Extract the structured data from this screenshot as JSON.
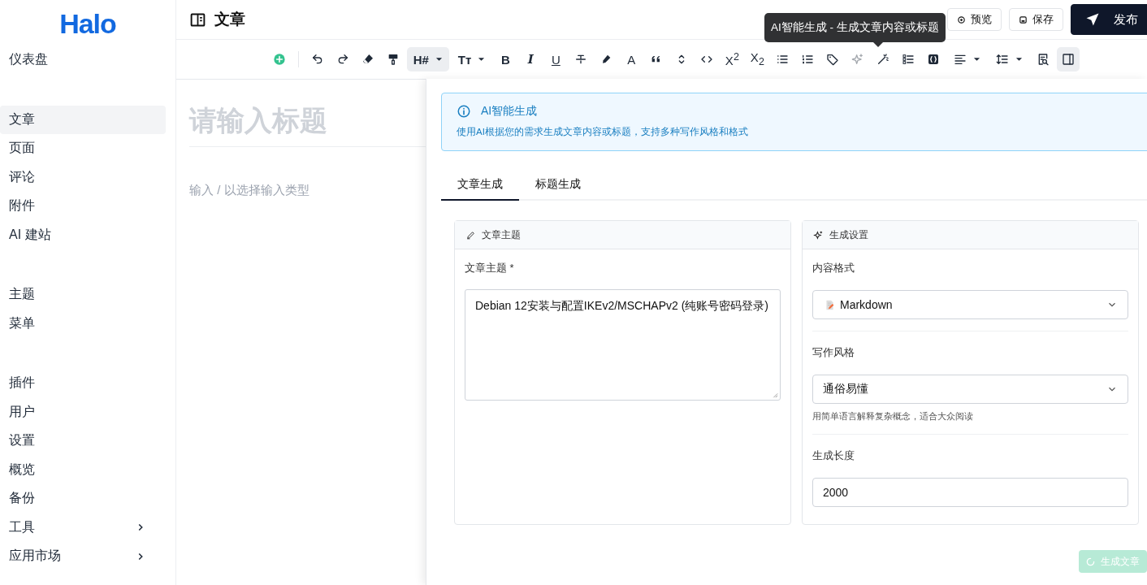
{
  "logo": {
    "text": "Halo"
  },
  "sidebar": {
    "groups": [
      {
        "items": [
          {
            "label": "仪表盘",
            "selected": false,
            "expandable": false
          }
        ]
      },
      {
        "items": [
          {
            "label": "文章",
            "selected": true,
            "expandable": false
          },
          {
            "label": "页面",
            "selected": false,
            "expandable": false
          },
          {
            "label": "评论",
            "selected": false,
            "expandable": false
          },
          {
            "label": "附件",
            "selected": false,
            "expandable": false
          },
          {
            "label": "AI 建站",
            "selected": false,
            "expandable": false
          }
        ]
      },
      {
        "items": [
          {
            "label": "主题",
            "selected": false,
            "expandable": false
          },
          {
            "label": "菜单",
            "selected": false,
            "expandable": false
          }
        ]
      },
      {
        "items": [
          {
            "label": "插件",
            "selected": false,
            "expandable": false
          },
          {
            "label": "用户",
            "selected": false,
            "expandable": false
          },
          {
            "label": "设置",
            "selected": false,
            "expandable": false
          },
          {
            "label": "概览",
            "selected": false,
            "expandable": false
          },
          {
            "label": "备份",
            "selected": false,
            "expandable": false
          },
          {
            "label": "工具",
            "selected": false,
            "expandable": true
          },
          {
            "label": "应用市场",
            "selected": false,
            "expandable": true
          }
        ]
      }
    ]
  },
  "header": {
    "title": "文章",
    "buttons": [
      {
        "kind": "preview",
        "label": "预览"
      },
      {
        "kind": "save",
        "label": "保存"
      },
      {
        "kind": "publish",
        "label": "发布"
      }
    ]
  },
  "toolbar": [
    {
      "kind": "icon",
      "selected": false,
      "disabled": false,
      "dropdown": false
    },
    {
      "kind": "icon",
      "selected": false,
      "disabled": false,
      "dropdown": false
    },
    {
      "kind": "icon",
      "selected": false,
      "disabled": false,
      "dropdown": false
    },
    {
      "kind": "icon",
      "selected": false,
      "disabled": false,
      "dropdown": false
    },
    {
      "kind": "icon",
      "selected": false,
      "disabled": false,
      "dropdown": false
    },
    {
      "kind": "glyph",
      "glyph": "H#",
      "selected": true,
      "disabled": false,
      "dropdown": true
    },
    {
      "kind": "glyph",
      "glyph": "Tт",
      "selected": false,
      "disabled": false,
      "dropdown": true
    },
    {
      "kind": "glyph",
      "glyph": "B",
      "selected": false,
      "disabled": false,
      "dropdown": false
    },
    {
      "kind": "glyph",
      "glyph": "I",
      "selected": false,
      "disabled": false,
      "dropdown": false
    },
    {
      "kind": "glyph",
      "glyph": "U",
      "selected": false,
      "disabled": false,
      "dropdown": false
    },
    {
      "kind": "icon",
      "selected": false,
      "disabled": false,
      "dropdown": false
    },
    {
      "kind": "icon",
      "selected": false,
      "disabled": false,
      "dropdown": false
    },
    {
      "kind": "glyph",
      "glyph": "A",
      "selected": false,
      "disabled": false,
      "dropdown": false
    },
    {
      "kind": "icon",
      "selected": false,
      "disabled": false,
      "dropdown": false
    },
    {
      "kind": "icon",
      "selected": false,
      "disabled": false,
      "dropdown": false
    },
    {
      "kind": "icon",
      "selected": false,
      "disabled": false,
      "dropdown": false
    },
    {
      "kind": "glyph",
      "glyph": "X$^{2}$",
      "selected": false,
      "disabled": false,
      "dropdown": false
    },
    {
      "kind": "glyph",
      "glyph": "X$_{2}$",
      "selected": false,
      "disabled": false,
      "dropdown": false
    },
    {
      "kind": "icon",
      "selected": false,
      "disabled": false,
      "dropdown": false
    },
    {
      "kind": "icon",
      "selected": false,
      "disabled": false,
      "dropdown": false
    },
    {
      "kind": "icon",
      "selected": false,
      "disabled": false,
      "dropdown": false
    },
    {
      "kind": "icon",
      "selected": false,
      "disabled": true,
      "dropdown": false
    },
    {
      "kind": "icon",
      "selected": false,
      "disabled": false,
      "dropdown": false
    },
    {
      "kind": "icon",
      "selected": false,
      "disabled": false,
      "dropdown": false
    },
    {
      "kind": "icon",
      "selected": false,
      "disabled": false,
      "dropdown": false
    },
    {
      "kind": "icon",
      "selected": false,
      "disabled": false,
      "dropdown": true
    },
    {
      "kind": "icon",
      "selected": false,
      "disabled": false,
      "dropdown": true
    },
    {
      "kind": "icon",
      "selected": false,
      "disabled": false,
      "dropdown": false
    },
    {
      "kind": "icon",
      "selected": true,
      "disabled": false,
      "dropdown": false
    }
  ],
  "tooltip": "AI智能生成 - 生成文章内容或标题",
  "editor": {
    "title_placeholder": "请输入标题",
    "body_placeholder": "输入 / 以选择输入类型"
  },
  "ai_panel": {
    "alert": {
      "title": "AI智能生成",
      "description": "使用AI根据您的需求生成文章内容或标题，支持多种写作风格和格式"
    },
    "tabs": [
      {
        "label": "文章生成",
        "selected": true
      },
      {
        "label": "标题生成",
        "selected": false
      }
    ],
    "topic_card": {
      "title": "文章主题",
      "field_label": "文章主题 *",
      "value": "Debian 12安装与配置IKEv2/MSCHAPv2 (纯账号密码登录)"
    },
    "settings_card": {
      "title": "生成设置",
      "fields": [
        {
          "kind": "select",
          "label": "内容格式",
          "value": "Markdown",
          "has_icon": true
        },
        {
          "kind": "select",
          "label": "写作风格",
          "value": "通俗易懂",
          "hint": "用简单语言解释复杂概念，适合大众阅读",
          "has_icon": false
        },
        {
          "kind": "input",
          "label": "生成长度",
          "value": "2000"
        }
      ]
    },
    "generate_button": {
      "label": "生成文章",
      "disabled": true,
      "loading": true
    }
  }
}
